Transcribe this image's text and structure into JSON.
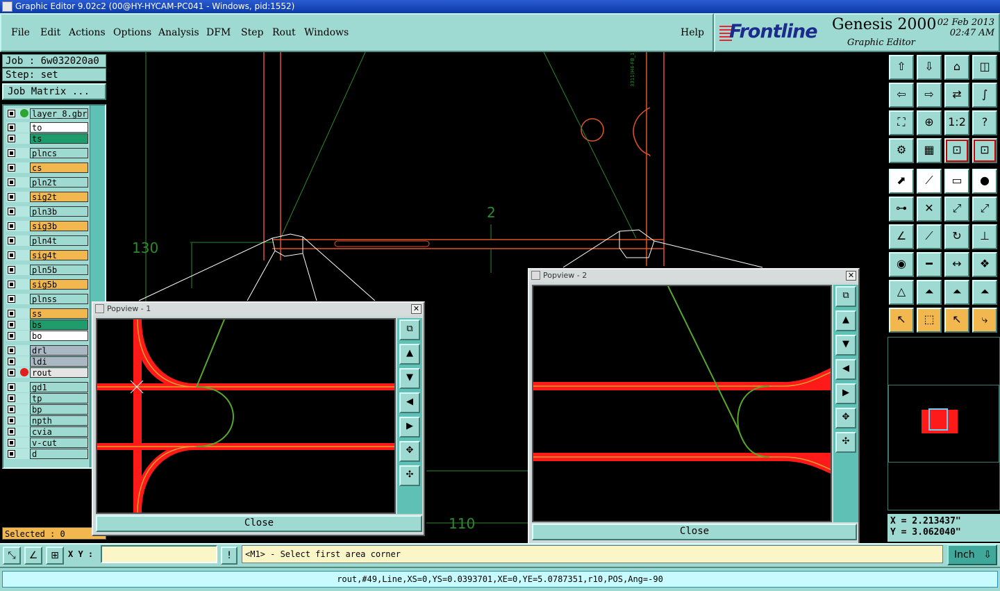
{
  "window": {
    "title": "Graphic Editor 9.02c2 (00@HY-HYCAM-PC041 - Windows, pid:1552)"
  },
  "menu": {
    "items": [
      "File",
      "Edit",
      "Actions",
      "Options",
      "Analysis",
      "DFM",
      "Step",
      "Rout",
      "Windows"
    ],
    "help": "Help"
  },
  "brand": {
    "logo": "Frontline",
    "product": "Genesis 2000",
    "subtitle": "Graphic Editor",
    "date": "02 Feb 2013",
    "time": "02:47 AM"
  },
  "job": {
    "job_label": "Job : 6w032020a0",
    "step_label": "Step: set",
    "matrix_button": "Job Matrix ..."
  },
  "layers": [
    {
      "name": "layer_8.gbr",
      "color": "#9fdad2",
      "dot": "#2ea52e"
    },
    {
      "name": "to",
      "color": "#ffffff"
    },
    {
      "name": "ts",
      "color": "#1f9c6c"
    },
    {
      "name": "plncs",
      "color": "#9fdad2"
    },
    {
      "name": "cs",
      "color": "#f2b84f"
    },
    {
      "name": "pln2t",
      "color": "#9fdad2"
    },
    {
      "name": "sig2t",
      "color": "#f2b84f"
    },
    {
      "name": "pln3b",
      "color": "#9fdad2"
    },
    {
      "name": "sig3b",
      "color": "#f2b84f"
    },
    {
      "name": "pln4t",
      "color": "#9fdad2"
    },
    {
      "name": "sig4t",
      "color": "#f2b84f"
    },
    {
      "name": "pln5b",
      "color": "#9fdad2"
    },
    {
      "name": "sig5b",
      "color": "#f2b84f"
    },
    {
      "name": "plnss",
      "color": "#9fdad2"
    },
    {
      "name": "ss",
      "color": "#f2b84f"
    },
    {
      "name": "bs",
      "color": "#1f9c6c"
    },
    {
      "name": "bo",
      "color": "#ffffff"
    },
    {
      "name": "drl",
      "color": "#a9b8c2"
    },
    {
      "name": "ldi",
      "color": "#a9b8c2"
    },
    {
      "name": "rout",
      "color": "#e4e4e4",
      "dot": "#e41c1c"
    },
    {
      "name": "gd1",
      "color": "#9fdad2"
    },
    {
      "name": "tp",
      "color": "#9fdad2"
    },
    {
      "name": "bp",
      "color": "#9fdad2"
    },
    {
      "name": "npth",
      "color": "#9fdad2"
    },
    {
      "name": "cvia",
      "color": "#9fdad2"
    },
    {
      "name": "v-cut",
      "color": "#9fdad2"
    },
    {
      "name": "d",
      "color": "#9fdad2"
    }
  ],
  "selected": "Selected : 0",
  "canvas": {
    "dim_top": "2",
    "dim_left": "130",
    "dim_bottom": "110",
    "side_text": "3311(H4-FB_1)21"
  },
  "popview1": {
    "title": "Popview - 1",
    "close": "Close"
  },
  "popview2": {
    "title": "Popview - 2",
    "close": "Close"
  },
  "coords": {
    "x": "X = 2.213437\"",
    "y": "Y = 3.062040\""
  },
  "bottom": {
    "xy_label": "X Y :",
    "xy_value": "",
    "bang": "!",
    "prompt": "<M1> - Select first area corner",
    "units": "Inch"
  },
  "status": "rout,#49,Line,XS=0,YS=0.0393701,XE=0,YE=5.0787351,r10,POS,Ang=-90",
  "toolbar_icons": [
    "home-up-icon",
    "home-down-icon",
    "house-icon",
    "window-icon",
    "arrow-left-icon",
    "arrow-right-icon",
    "swap-icon",
    "s-curve-icon",
    "fit-icon",
    "center-icon",
    "ratio-icon",
    "help-icon",
    "tools-icon",
    "grid-icon",
    "layers-red-icon",
    "layers-red2-icon",
    "select-icon",
    "measure-icon",
    "ruler-icon",
    "pad-icon",
    "net-icon",
    "cross-icon",
    "snap-icon",
    "snap2-icon",
    "angle-icon",
    "line-icon",
    "arc-icon",
    "split-icon",
    "pad2-icon",
    "minus-icon",
    "dim-icon",
    "blob-icon",
    "triangle-icon",
    "triangle2-icon",
    "triangle3-icon",
    "triangle4-icon",
    "pointer-icon",
    "pointer2-icon",
    "pointer3-icon",
    "route-icon"
  ]
}
